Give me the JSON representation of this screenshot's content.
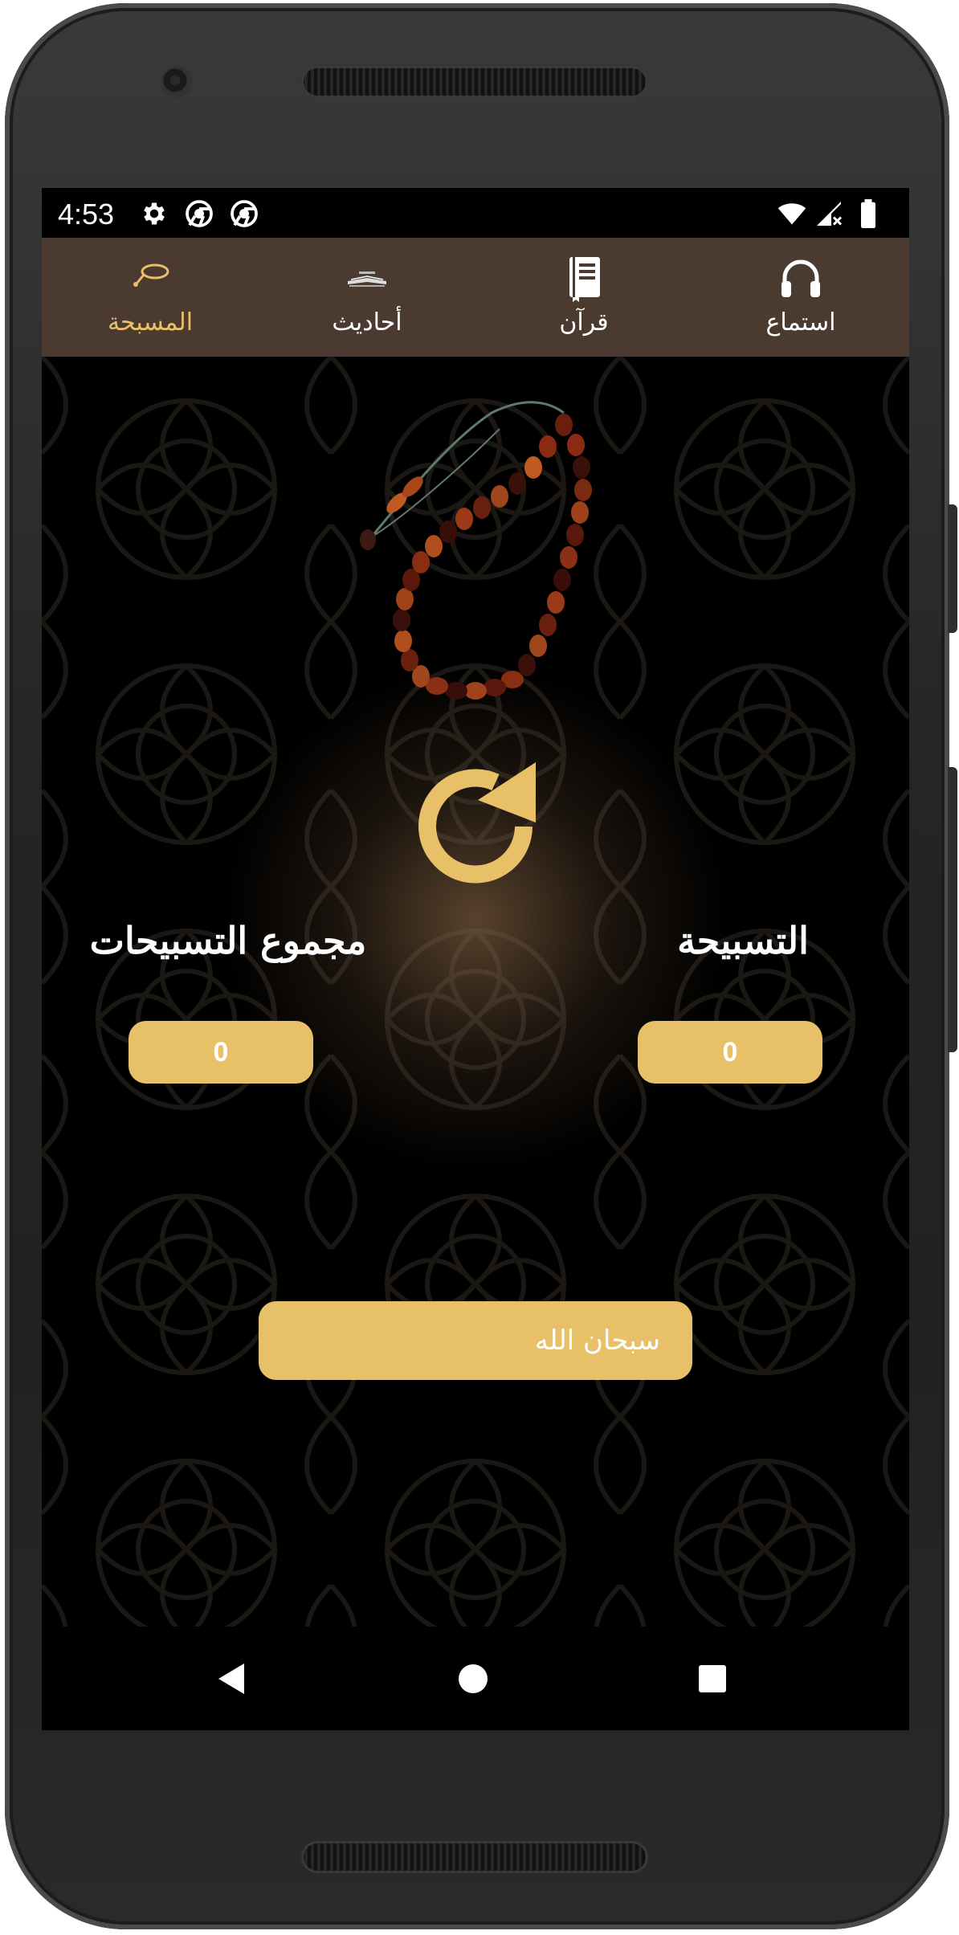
{
  "status_bar": {
    "time": "4:53",
    "left_icons": [
      "gear-icon",
      "chrome-icon",
      "chrome-icon"
    ],
    "right_icons": [
      "wifi-icon",
      "signal-no-data-icon",
      "battery-icon"
    ]
  },
  "tabs": [
    {
      "id": "masbaha",
      "label": "المسبحة",
      "icon": "prayer-beads-icon",
      "active": true
    },
    {
      "id": "ahadith",
      "label": "أحاديث",
      "icon": "open-book-icon",
      "active": false
    },
    {
      "id": "quran",
      "label": "قرآن",
      "icon": "quran-book-icon",
      "active": false
    },
    {
      "id": "listen",
      "label": "استماع",
      "icon": "headphones-icon",
      "active": false
    }
  ],
  "masbaha": {
    "total_label": "مجموع التسبيحات",
    "count_label": "التسبيحة",
    "total_value": "0",
    "count_value": "0",
    "tasbih_button": "سبحان الله",
    "reset_icon": "refresh-icon"
  },
  "colors": {
    "accent": "#e8c068",
    "tab_bar": "#4b3a2f",
    "background": "#000000"
  }
}
